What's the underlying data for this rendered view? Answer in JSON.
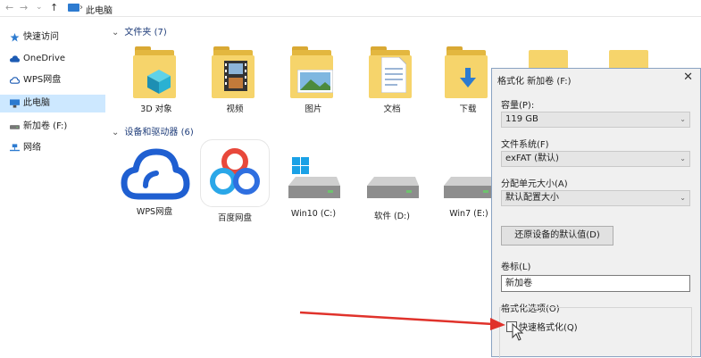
{
  "address": {
    "back": "←",
    "forward": "→",
    "recent": "⌄",
    "up": "↑",
    "breadcrumb_sep": "›",
    "breadcrumb": "此电脑"
  },
  "sidebar": {
    "items": [
      {
        "label": "快速访问",
        "icon": "star-icon"
      },
      {
        "label": "OneDrive",
        "icon": "cloud-icon"
      },
      {
        "label": "WPS网盘",
        "icon": "wps-cloud-icon"
      },
      {
        "label": "此电脑",
        "icon": "computer-icon",
        "selected": true
      },
      {
        "label": "新加卷 (F:)",
        "icon": "drive-icon"
      },
      {
        "label": "网络",
        "icon": "network-icon"
      }
    ]
  },
  "main": {
    "folders_header": "文件夹 (7)",
    "folders": [
      "3D 对象",
      "视频",
      "图片",
      "文档",
      "下载"
    ],
    "devices_header": "设备和驱动器 (6)",
    "devices": [
      "WPS网盘",
      "百度网盘",
      "Win10 (C:)",
      "软件 (D:)",
      "Win7 (E:)"
    ]
  },
  "dialog": {
    "title": "格式化 新加卷 (F:)",
    "close": "✕",
    "capacity_label": "容量(P):",
    "capacity_value": "119 GB",
    "fs_label": "文件系统(F)",
    "fs_value": "exFAT (默认)",
    "alloc_label": "分配单元大小(A)",
    "alloc_value": "默认配置大小",
    "restore_button": "还原设备的默认值(D)",
    "volume_label": "卷标(L)",
    "volume_value": "新加卷",
    "options_label": "格式化选项(O)",
    "quick_format": "快速格式化(Q)",
    "combo_arrow": "⌄"
  },
  "colors": {
    "accent": "#2d7bd0",
    "selection": "#cde8ff",
    "arrow": "#e0322b"
  }
}
